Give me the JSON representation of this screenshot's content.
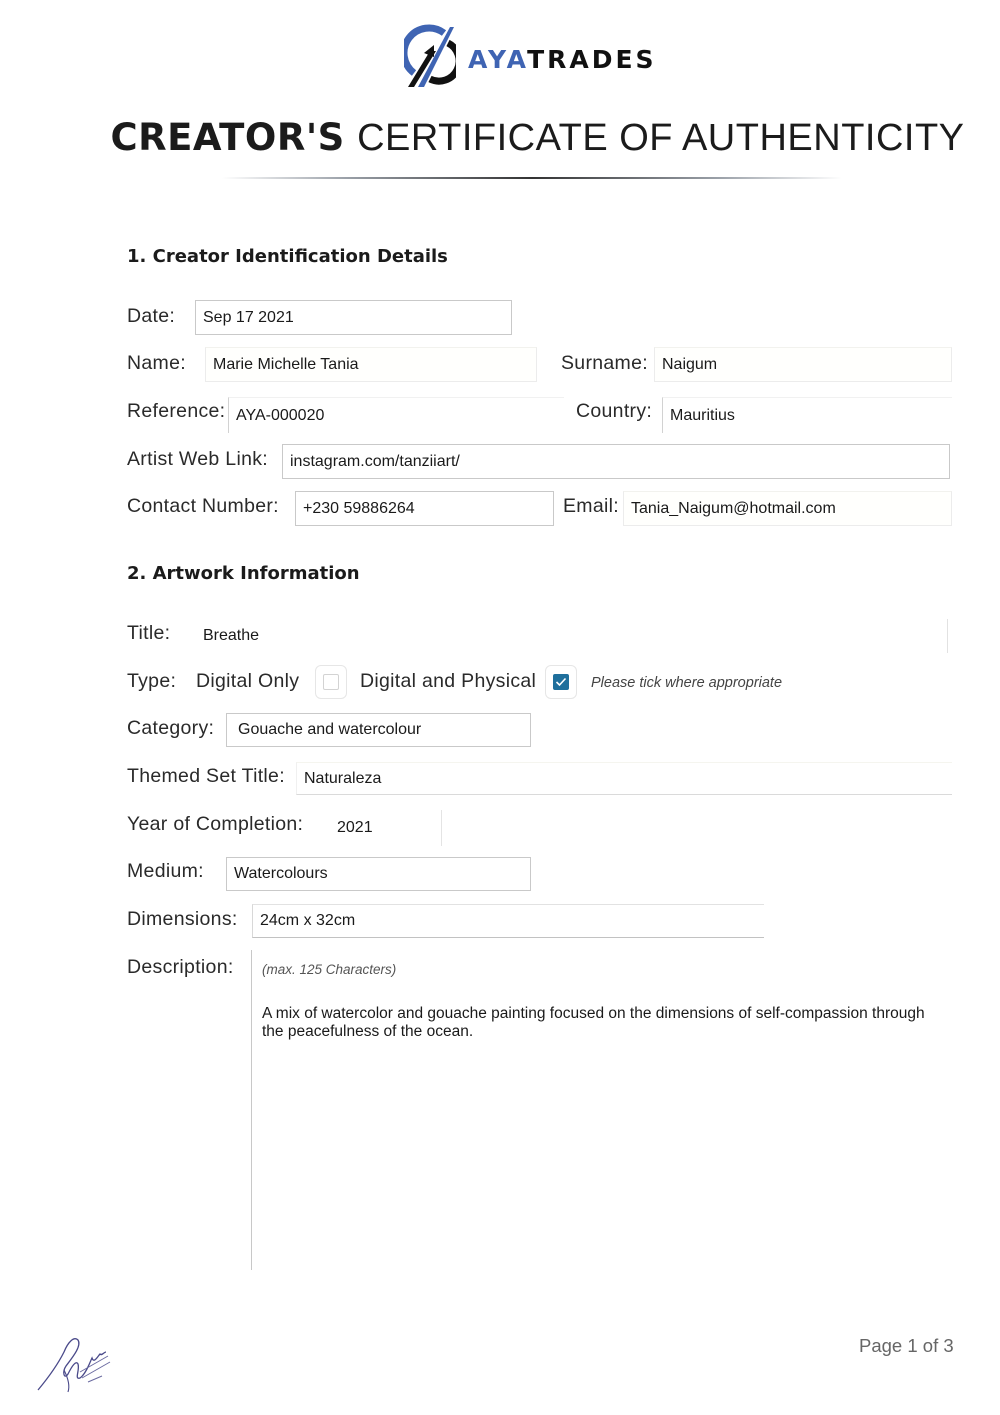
{
  "brand": {
    "name_part1": "AYA",
    "name_part2": "TRADES",
    "accent_color": "#3f64b3",
    "logo_icon": "ayatrades-logo-icon"
  },
  "document": {
    "title_bold": "CREATOR'S",
    "title_light": "CERTIFICATE OF AUTHENTICITY"
  },
  "section1": {
    "heading": "1. Creator Identification Details",
    "date": {
      "label": "Date:",
      "value": "Sep 17 2021"
    },
    "name": {
      "label": "Name:",
      "value": "Marie Michelle Tania"
    },
    "surname": {
      "label": "Surname:",
      "value": "Naigum"
    },
    "reference": {
      "label": "Reference:",
      "value": "AYA-000020"
    },
    "country": {
      "label": "Country:",
      "value": "Mauritius"
    },
    "web_link": {
      "label": "Artist Web Link:",
      "value": "instagram.com/tanziiart/"
    },
    "contact_number": {
      "label": "Contact Number:",
      "value": "+230 59886264"
    },
    "email": {
      "label": "Email:",
      "value": "Tania_Naigum@hotmail.com"
    }
  },
  "section2": {
    "heading": "2. Artwork Information",
    "title": {
      "label": "Title:",
      "value": "Breathe"
    },
    "type": {
      "label": "Type:",
      "options": [
        {
          "label": "Digital Only",
          "checked": false
        },
        {
          "label": "Digital and Physical",
          "checked": true
        }
      ],
      "hint": "Please tick where appropriate",
      "check_color": "#1f6f9c"
    },
    "category": {
      "label": "Category:",
      "value": "Gouache and watercolour"
    },
    "themed_set_title": {
      "label": "Themed Set Title:",
      "value": "Naturaleza"
    },
    "year_of_completion": {
      "label": "Year of Completion:",
      "value": "2021"
    },
    "medium": {
      "label": "Medium:",
      "value": "Watercolours"
    },
    "dimensions": {
      "label": "Dimensions:",
      "value": "24cm x 32cm"
    },
    "description": {
      "label": "Description:",
      "hint": "(max. 125 Characters)",
      "value": "A mix of watercolor and gouache painting focused on the dimensions of self-compassion through the peacefulness of the ocean."
    }
  },
  "footer": {
    "signature": "signature",
    "page_indicator": "Page 1 of 3"
  }
}
